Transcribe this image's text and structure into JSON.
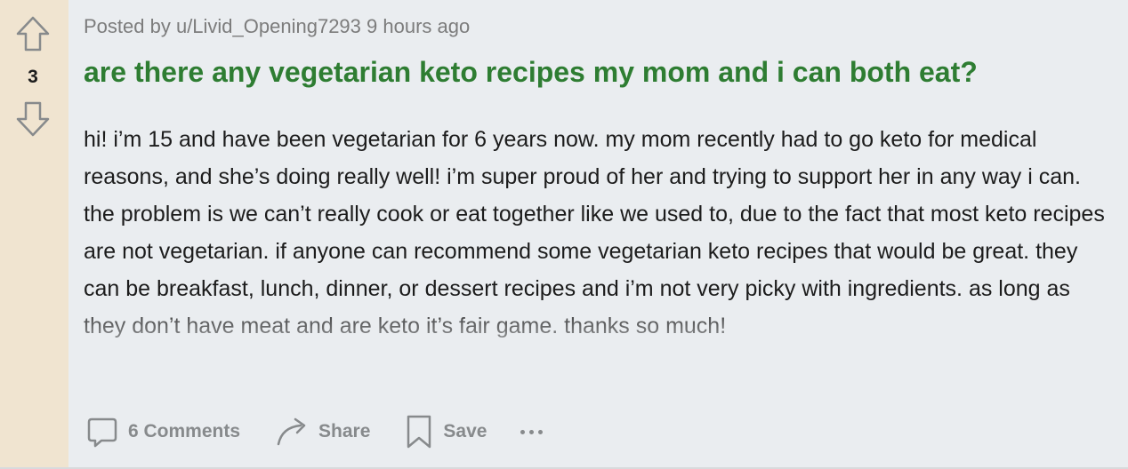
{
  "post": {
    "votes": "3",
    "posted_by": "Posted by u/Livid_Opening7293",
    "time_ago": "9 hours ago",
    "title": "are there any vegetarian keto recipes my mom and i can both eat?",
    "body": "hi! i’m 15 and have been vegetarian for 6 years now. my mom recently had to go keto for medical reasons, and she’s doing really well! i’m super proud of her and trying to support her in any way i can. the problem is we can’t really cook or eat together like we used to, due to the fact that most keto recipes are not vegetarian. if anyone can recommend some vegetarian keto recipes that would be great. they can be breakfast, lunch, dinner, or dessert recipes and i’m not very picky with ingredients. as long as they don’t have meat and are keto it’s fair game. thanks so much!"
  },
  "actions": {
    "comments_label": "6 Comments",
    "share_label": "Share",
    "save_label": "Save"
  },
  "icons": {
    "upvote": "upvote-arrow-icon",
    "downvote": "downvote-arrow-icon",
    "comment": "comment-bubble-icon",
    "share": "share-arrow-icon",
    "save": "bookmark-icon",
    "more": "more-dots-icon"
  },
  "colors": {
    "title": "#2e7d32",
    "vote_column": "#f0e4d0",
    "background": "#eaedf0",
    "action_text": "#878a8c"
  }
}
